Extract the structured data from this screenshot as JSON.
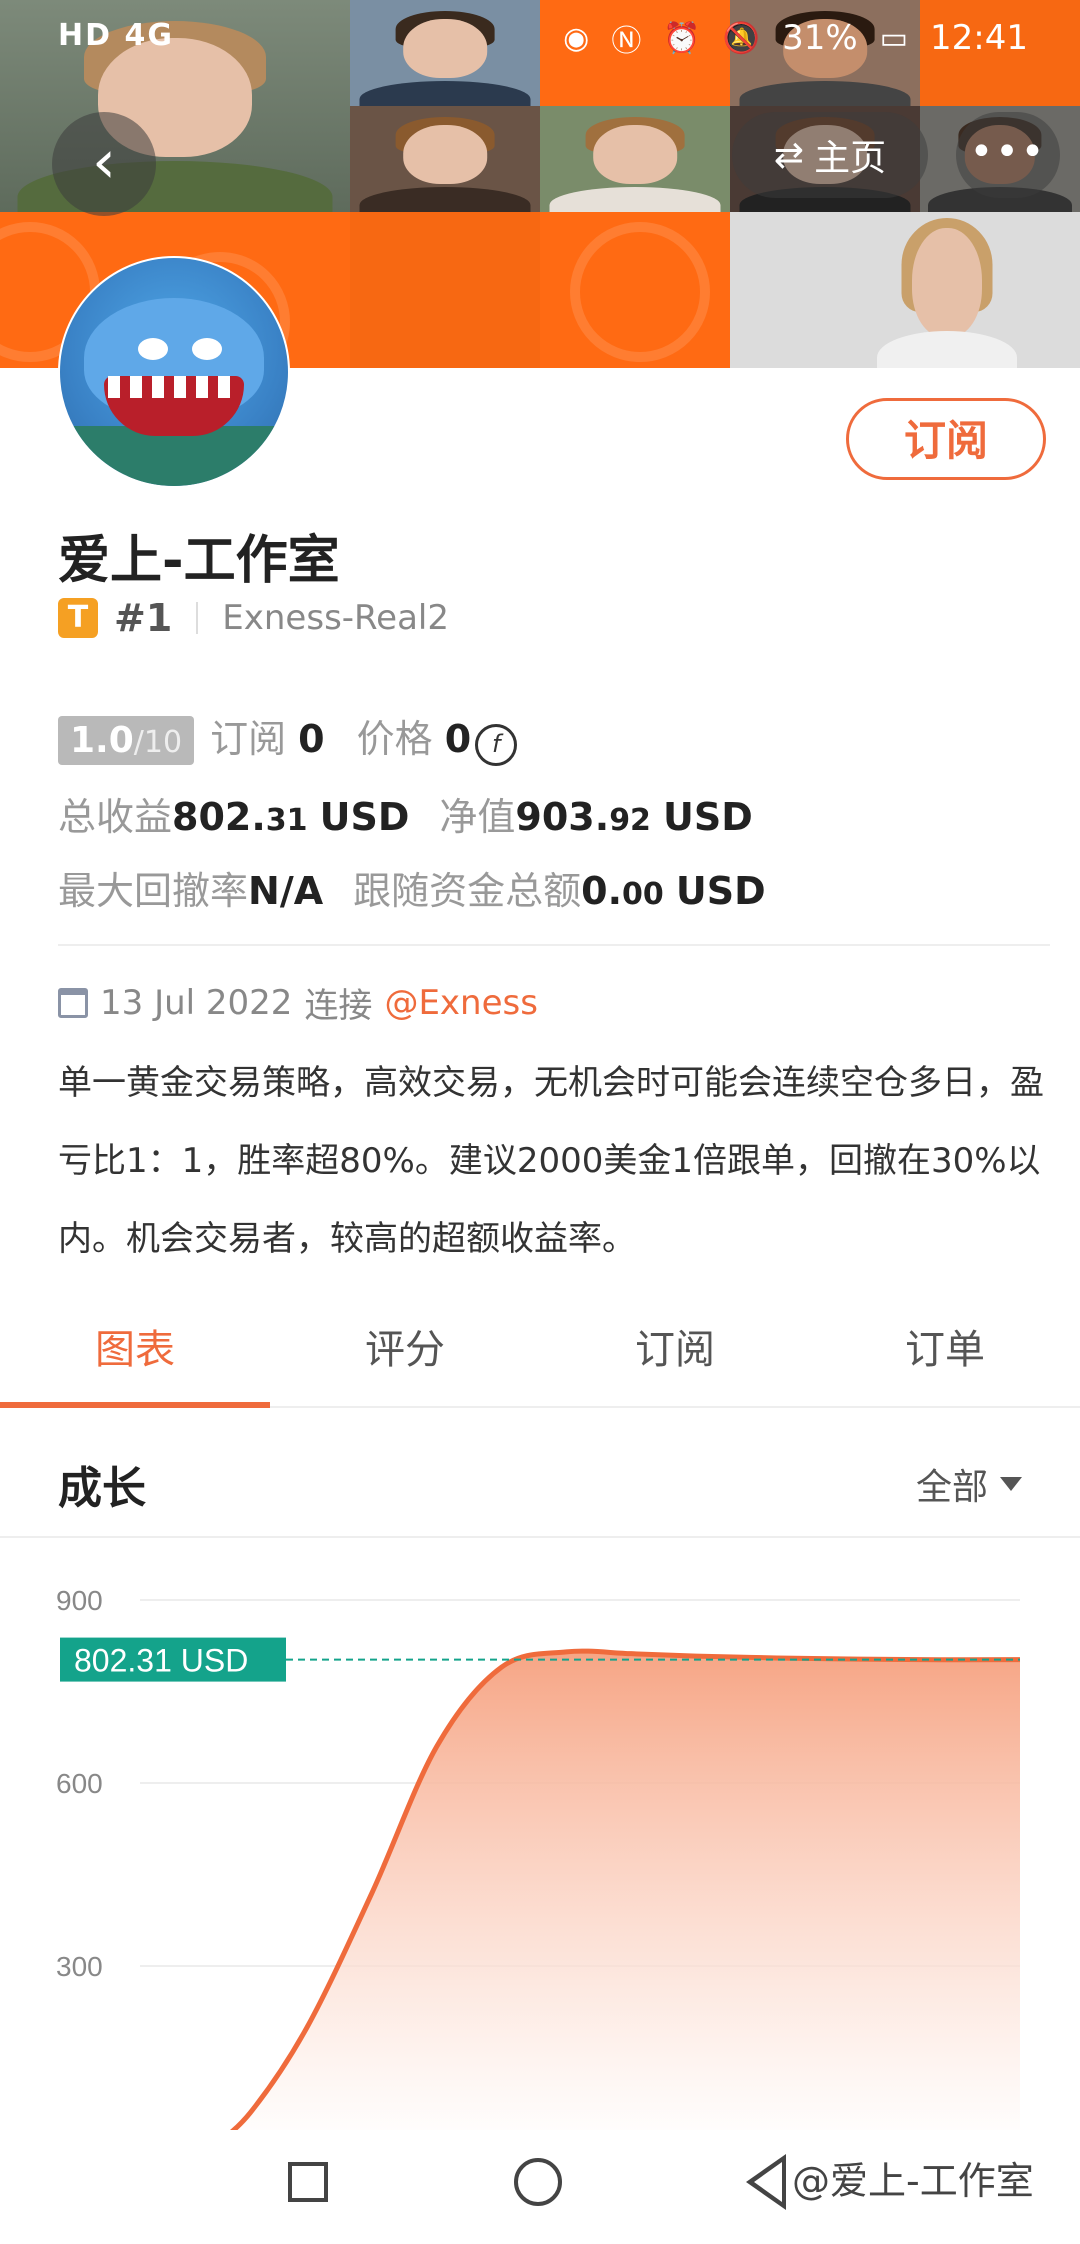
{
  "status_bar": {
    "left_text": "HD 4G",
    "battery": "31%",
    "time": "12:41"
  },
  "header": {
    "home_label": "主页",
    "more_label": "•••"
  },
  "profile": {
    "subscribe_label": "订阅",
    "name": "爱上-工作室",
    "badge_letter": "T",
    "rank": "#1",
    "account": "Exness-Real2"
  },
  "stats": {
    "score": "1.0",
    "score_max": "/10",
    "subscribe_label": "订阅",
    "subscribe_count": "0",
    "price_label": "价格",
    "price_value": "0",
    "price_icon": "coin-icon",
    "total_profit_label": "总收益",
    "total_profit_int": "802.",
    "total_profit_dec": "31",
    "total_profit_unit": "USD",
    "equity_label": "净值",
    "equity_int": "903.",
    "equity_dec": "92",
    "equity_unit": "USD",
    "max_drawdown_label": "最大回撤率",
    "max_drawdown_value": "N/A",
    "follow_funds_label": "跟随资金总额",
    "follow_funds_int": "0.",
    "follow_funds_dec": "00",
    "follow_funds_unit": "USD"
  },
  "connection": {
    "date": "13 Jul 2022",
    "connect_label": "连接",
    "broker": "@Exness"
  },
  "description": "单一黄金交易策略，高效交易，无机会时可能会连续空仓多日，盈亏比1：1，胜率超80%。建议2000美金1倍跟单，回撤在30%以内。机会交易者，较高的超额收益率。",
  "tabs": [
    {
      "label": "图表",
      "active": true
    },
    {
      "label": "评分",
      "active": false
    },
    {
      "label": "订阅",
      "active": false
    },
    {
      "label": "订单",
      "active": false
    }
  ],
  "growth": {
    "title": "成长",
    "range_label": "全部"
  },
  "chart_data": {
    "type": "area",
    "y_ticks": [
      "900",
      "600",
      "300"
    ],
    "ylim": [
      0,
      900
    ],
    "current_label": "802.31 USD",
    "current_value": 802.31,
    "x": [
      0,
      0.05,
      0.12,
      0.2,
      0.28,
      0.36,
      0.44,
      0.52,
      0.6,
      0.7,
      0.8,
      0.9,
      1.0
    ],
    "values": [
      0,
      60,
      200,
      420,
      660,
      790,
      815,
      812,
      808,
      805,
      803,
      802,
      802.31
    ],
    "line_color": "#ef6b3c",
    "reference_color": "#14a38b"
  },
  "watermark": "@爱上-工作室"
}
